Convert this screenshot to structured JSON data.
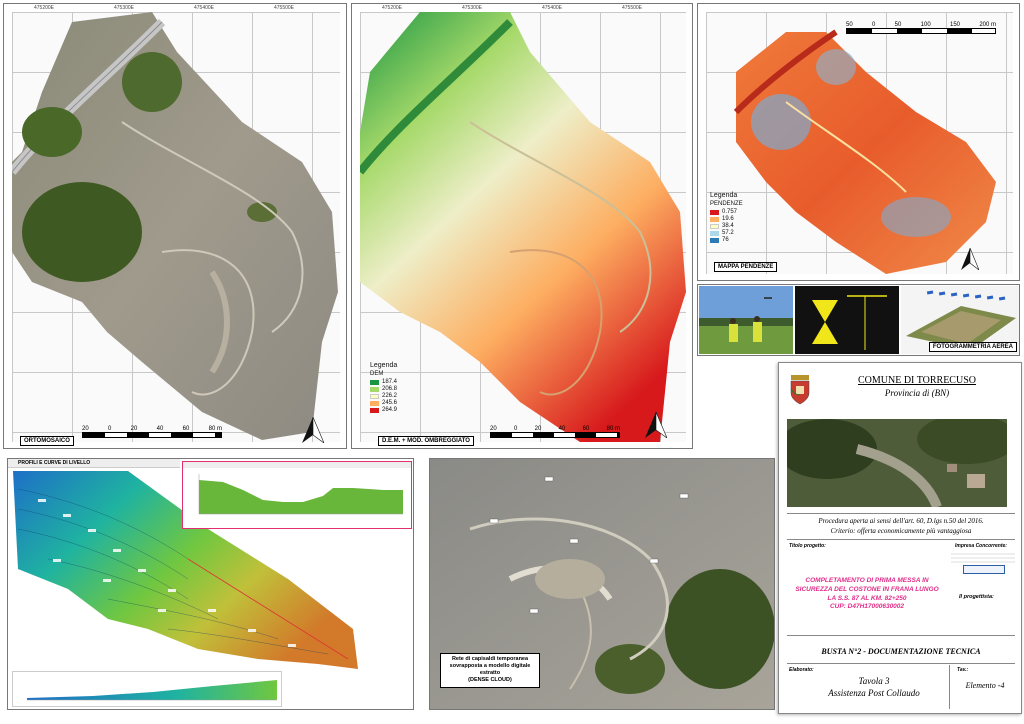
{
  "panels": {
    "orthomosaic": {
      "label": "ORTOMOSAICO",
      "scale_labels": [
        "20",
        "0",
        "20",
        "40",
        "60",
        "80 m"
      ],
      "x_ticks": [
        "475200E",
        "475300E",
        "475400E",
        "475500E"
      ],
      "y_ticks": [
        "4561200N",
        "4561100N",
        "4561000N",
        "4560900N",
        "4560800N",
        "4560700N"
      ]
    },
    "dem": {
      "label": "D.E.M. + MOD. OMBREGGIATO",
      "scale_labels": [
        "20",
        "0",
        "20",
        "40",
        "60",
        "80 m"
      ],
      "x_ticks": [
        "475200E",
        "475300E",
        "475400E",
        "475500E"
      ],
      "legend_title": "Legenda",
      "legend_subtitle": "DEM",
      "legend_items": [
        {
          "value": "187.4",
          "color": "#1a9641"
        },
        {
          "value": "206.8",
          "color": "#a6d96a"
        },
        {
          "value": "226.2",
          "color": "#ffffbf"
        },
        {
          "value": "245.6",
          "color": "#fdae61"
        },
        {
          "value": "264.9",
          "color": "#d7191c"
        }
      ]
    },
    "slope": {
      "label": "MAPPA PENDENZE",
      "scale_labels": [
        "50",
        "0",
        "50",
        "100",
        "150",
        "200 m"
      ],
      "x_ticks": [
        "475200E",
        "475300E",
        "475400E",
        "475500E"
      ],
      "legend_title": "Legenda",
      "legend_subtitle": "PENDENZE",
      "legend_items": [
        {
          "value": "0.757",
          "color": "#d7191c"
        },
        {
          "value": "19.6",
          "color": "#fdae61"
        },
        {
          "value": "38.4",
          "color": "#ffffbf"
        },
        {
          "value": "57.2",
          "color": "#abd9e9"
        },
        {
          "value": "76",
          "color": "#2c7bb6"
        }
      ]
    },
    "aerial": {
      "label": "FOTOGRAMMETRIA AEREA"
    },
    "profiles": {
      "label": "PROFILI E CURVE DI LIVELLO"
    },
    "dense_cloud": {
      "caption_lines": [
        "Rete di capisaldi temporanea",
        "sovrapposta a modello digitale estratto",
        "(DENSE CLOUD)"
      ]
    }
  },
  "title_block": {
    "municipality": "COMUNE DI TORRECUSO",
    "province": "Provincia di (BN)",
    "procedure_line1": "Procedura aperta ai sensi dell'art. 60, D.lgs n.50 del 2016.",
    "procedure_line2": "Criterio: offerta economicamente più vantaggiosa",
    "project_label": "Titolo progetto:",
    "company_label": "Impresa Concorrente:",
    "project_lines": [
      "COMPLETAMENTO DI PRIMA MESSA IN",
      "SICUREZZA DEL COSTONE IN FRANA LUNGO",
      "LA S.S. 87 AL KM. 82+250",
      "CUP: D47H17000630002"
    ],
    "designer_label": "Il progettista:",
    "envelope": "BUSTA N°2 - DOCUMENTAZIONE TECNICA",
    "elaborate_label": "Elaborato:",
    "tav_label": "Tav.:",
    "tavola": "Tavola 3",
    "subtitle": "Assistenza Post Collaudo",
    "element": "Elemento -4"
  }
}
